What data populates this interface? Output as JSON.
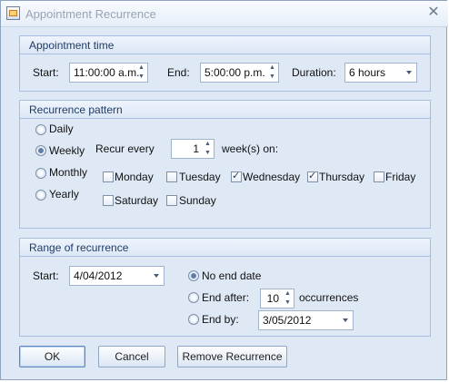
{
  "window": {
    "title": "Appointment Recurrence",
    "close_symbol": "✕"
  },
  "appointment_time": {
    "heading": "Appointment time",
    "start_label": "Start:",
    "start_value": "11:00:00 a.m.",
    "end_label": "End:",
    "end_value": "5:00:00 p.m.",
    "duration_label": "Duration:",
    "duration_value": "6 hours"
  },
  "recurrence_pattern": {
    "heading": "Recurrence pattern",
    "options": [
      "Daily",
      "Weekly",
      "Monthly",
      "Yearly"
    ],
    "selected_option": "Weekly",
    "recur_every_label": "Recur every",
    "recur_every_value": "1",
    "weeks_on_label": "week(s) on:",
    "days": [
      {
        "label": "Monday",
        "checked": false
      },
      {
        "label": "Tuesday",
        "checked": false
      },
      {
        "label": "Wednesday",
        "checked": true
      },
      {
        "label": "Thursday",
        "checked": true
      },
      {
        "label": "Friday",
        "checked": false
      },
      {
        "label": "Saturday",
        "checked": false
      },
      {
        "label": "Sunday",
        "checked": false
      }
    ]
  },
  "range_of_recurrence": {
    "heading": "Range of recurrence",
    "start_label": "Start:",
    "start_value": "4/04/2012",
    "no_end_date_label": "No end date",
    "end_after_label": "End after:",
    "end_after_value": "10",
    "occurrences_label": "occurrences",
    "end_by_label": "End by:",
    "end_by_value": "3/05/2012",
    "selected_option": "No end date"
  },
  "buttons": {
    "ok": "OK",
    "cancel": "Cancel",
    "remove": "Remove Recurrence"
  }
}
